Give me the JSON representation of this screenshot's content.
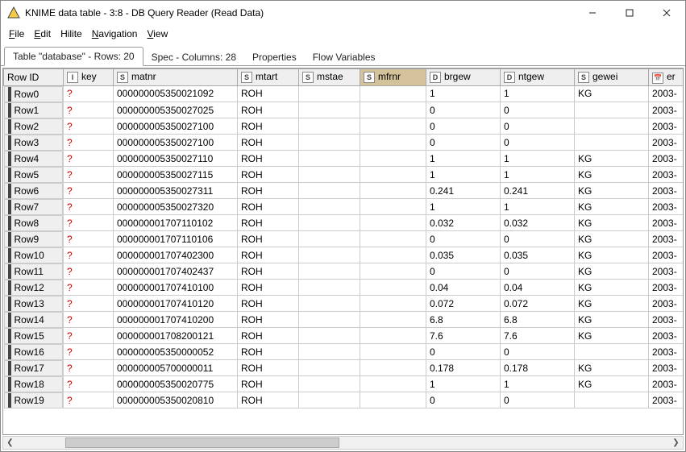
{
  "window": {
    "title": "KNIME data table - 3:8 - DB Query Reader (Read Data)"
  },
  "menu": {
    "file": "File",
    "edit": "Edit",
    "hilite": "Hilite",
    "navigation": "Navigation",
    "view": "View"
  },
  "tabs": {
    "t0": "Table \"database\" - Rows: 20",
    "t1": "Spec - Columns: 28",
    "t2": "Properties",
    "t3": "Flow Variables"
  },
  "columns": {
    "rowid": "Row ID",
    "key": "key",
    "matnr": "matnr",
    "mtart": "mtart",
    "mstae": "mstae",
    "mfrnr": "mfrnr",
    "brgew": "brgew",
    "ntgew": "ntgew",
    "gewei": "gewei",
    "er": "er"
  },
  "coltypes": {
    "key": "I",
    "matnr": "S",
    "mtart": "S",
    "mstae": "S",
    "mfrnr": "S",
    "brgew": "D",
    "ntgew": "D",
    "gewei": "S",
    "er": "📅"
  },
  "rows": [
    {
      "id": "Row0",
      "key": "?",
      "matnr": "000000005350021092",
      "mtart": "ROH",
      "mstae": "",
      "mfrnr": "",
      "brgew": "1",
      "ntgew": "1",
      "gewei": "KG",
      "er": "2003-"
    },
    {
      "id": "Row1",
      "key": "?",
      "matnr": "000000005350027025",
      "mtart": "ROH",
      "mstae": "",
      "mfrnr": "",
      "brgew": "0",
      "ntgew": "0",
      "gewei": "",
      "er": "2003-"
    },
    {
      "id": "Row2",
      "key": "?",
      "matnr": "000000005350027100",
      "mtart": "ROH",
      "mstae": "",
      "mfrnr": "",
      "brgew": "0",
      "ntgew": "0",
      "gewei": "",
      "er": "2003-"
    },
    {
      "id": "Row3",
      "key": "?",
      "matnr": "000000005350027100",
      "mtart": "ROH",
      "mstae": "",
      "mfrnr": "",
      "brgew": "0",
      "ntgew": "0",
      "gewei": "",
      "er": "2003-"
    },
    {
      "id": "Row4",
      "key": "?",
      "matnr": "000000005350027110",
      "mtart": "ROH",
      "mstae": "",
      "mfrnr": "",
      "brgew": "1",
      "ntgew": "1",
      "gewei": "KG",
      "er": "2003-"
    },
    {
      "id": "Row5",
      "key": "?",
      "matnr": "000000005350027115",
      "mtart": "ROH",
      "mstae": "",
      "mfrnr": "",
      "brgew": "1",
      "ntgew": "1",
      "gewei": "KG",
      "er": "2003-"
    },
    {
      "id": "Row6",
      "key": "?",
      "matnr": "000000005350027311",
      "mtart": "ROH",
      "mstae": "",
      "mfrnr": "",
      "brgew": "0.241",
      "ntgew": "0.241",
      "gewei": "KG",
      "er": "2003-"
    },
    {
      "id": "Row7",
      "key": "?",
      "matnr": "000000005350027320",
      "mtart": "ROH",
      "mstae": "",
      "mfrnr": "",
      "brgew": "1",
      "ntgew": "1",
      "gewei": "KG",
      "er": "2003-"
    },
    {
      "id": "Row8",
      "key": "?",
      "matnr": "000000001707110102",
      "mtart": "ROH",
      "mstae": "",
      "mfrnr": "",
      "brgew": "0.032",
      "ntgew": "0.032",
      "gewei": "KG",
      "er": "2003-"
    },
    {
      "id": "Row9",
      "key": "?",
      "matnr": "000000001707110106",
      "mtart": "ROH",
      "mstae": "",
      "mfrnr": "",
      "brgew": "0",
      "ntgew": "0",
      "gewei": "KG",
      "er": "2003-"
    },
    {
      "id": "Row10",
      "key": "?",
      "matnr": "000000001707402300",
      "mtart": "ROH",
      "mstae": "",
      "mfrnr": "",
      "brgew": "0.035",
      "ntgew": "0.035",
      "gewei": "KG",
      "er": "2003-"
    },
    {
      "id": "Row11",
      "key": "?",
      "matnr": "000000001707402437",
      "mtart": "ROH",
      "mstae": "",
      "mfrnr": "",
      "brgew": "0",
      "ntgew": "0",
      "gewei": "KG",
      "er": "2003-"
    },
    {
      "id": "Row12",
      "key": "?",
      "matnr": "000000001707410100",
      "mtart": "ROH",
      "mstae": "",
      "mfrnr": "",
      "brgew": "0.04",
      "ntgew": "0.04",
      "gewei": "KG",
      "er": "2003-"
    },
    {
      "id": "Row13",
      "key": "?",
      "matnr": "000000001707410120",
      "mtart": "ROH",
      "mstae": "",
      "mfrnr": "",
      "brgew": "0.072",
      "ntgew": "0.072",
      "gewei": "KG",
      "er": "2003-"
    },
    {
      "id": "Row14",
      "key": "?",
      "matnr": "000000001707410200",
      "mtart": "ROH",
      "mstae": "",
      "mfrnr": "",
      "brgew": "6.8",
      "ntgew": "6.8",
      "gewei": "KG",
      "er": "2003-"
    },
    {
      "id": "Row15",
      "key": "?",
      "matnr": "000000001708200121",
      "mtart": "ROH",
      "mstae": "",
      "mfrnr": "",
      "brgew": "7.6",
      "ntgew": "7.6",
      "gewei": "KG",
      "er": "2003-"
    },
    {
      "id": "Row16",
      "key": "?",
      "matnr": "000000005350000052",
      "mtart": "ROH",
      "mstae": "",
      "mfrnr": "",
      "brgew": "0",
      "ntgew": "0",
      "gewei": "",
      "er": "2003-"
    },
    {
      "id": "Row17",
      "key": "?",
      "matnr": "000000005700000011",
      "mtart": "ROH",
      "mstae": "",
      "mfrnr": "",
      "brgew": "0.178",
      "ntgew": "0.178",
      "gewei": "KG",
      "er": "2003-"
    },
    {
      "id": "Row18",
      "key": "?",
      "matnr": "000000005350020775",
      "mtart": "ROH",
      "mstae": "",
      "mfrnr": "",
      "brgew": "1",
      "ntgew": "1",
      "gewei": "KG",
      "er": "2003-"
    },
    {
      "id": "Row19",
      "key": "?",
      "matnr": "000000005350020810",
      "mtart": "ROH",
      "mstae": "",
      "mfrnr": "",
      "brgew": "0",
      "ntgew": "0",
      "gewei": "",
      "er": "2003-"
    }
  ]
}
